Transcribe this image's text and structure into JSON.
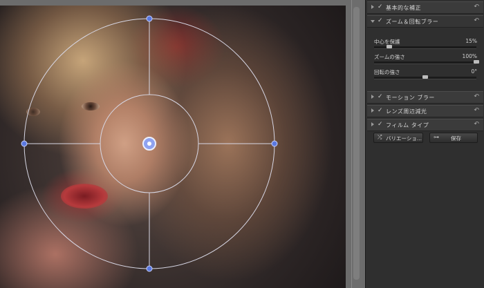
{
  "panel": {
    "sections": [
      {
        "label": "基本的な補正",
        "checked": "✓",
        "reset_icon": "reset-arrow-icon"
      },
      {
        "label": "ズーム＆回転ブラー",
        "checked": "✓",
        "reset_icon": "reset-arrow-icon",
        "expanded": true
      },
      {
        "label": "モーション ブラー",
        "checked": "✓",
        "reset_icon": "reset-arrow-icon"
      },
      {
        "label": "レンズ周辺減光",
        "checked": "✓",
        "reset_icon": "reset-arrow-icon"
      },
      {
        "label": "フィルム タイプ",
        "checked": "✓",
        "reset_icon": "reset-arrow-icon"
      }
    ],
    "sliders": [
      {
        "label": "中心を保護",
        "value": "15%",
        "level": 0.15
      },
      {
        "label": "ズームの強さ",
        "value": "100%",
        "level": 1.0
      },
      {
        "label": "回転の強さ",
        "value": "0°",
        "level": 0.5
      }
    ],
    "buttons": {
      "variations_label": "バリエーショ...",
      "save_label": "保存"
    }
  },
  "colors": {
    "panel_bg": "#2f2f2f",
    "header_bg": "#3b3b3b",
    "overlay_line": "#d8d8e6",
    "handle_blue": "#5a78e0"
  }
}
